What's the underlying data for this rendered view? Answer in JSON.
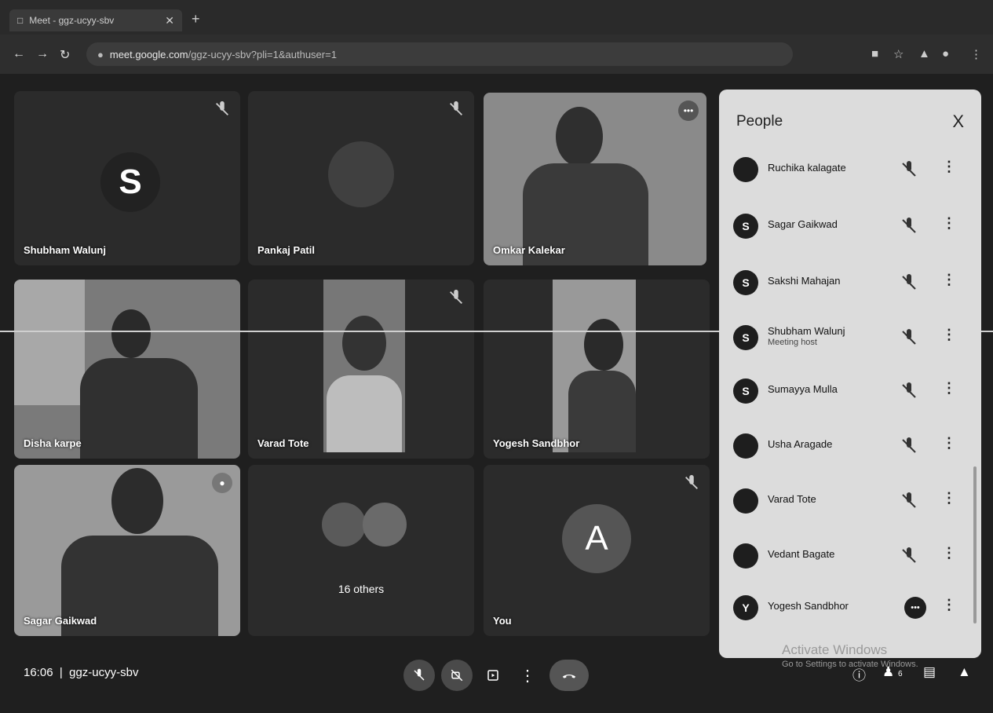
{
  "browser": {
    "tab_title": "Meet - ggz-ucyy-sbv",
    "url_domain": "meet.google.com",
    "url_path": "/ggz-ucyy-sbv?pli=1&authuser=1"
  },
  "tiles": [
    {
      "name": "Shubham Walunj",
      "initial": "S"
    },
    {
      "name": "Pankaj Patil"
    },
    {
      "name": "Omkar Kalekar"
    },
    {
      "name": "Disha karpe"
    },
    {
      "name": "Varad Tote"
    },
    {
      "name": "Yogesh Sandbhor"
    },
    {
      "name": "Sagar Gaikwad"
    },
    {
      "name": "16 others"
    },
    {
      "name": "You",
      "initial": "A"
    }
  ],
  "people_panel": {
    "title": "People",
    "close_label": "X",
    "participants": [
      {
        "name": "Ruchika kalagate",
        "initial": ""
      },
      {
        "name": "Sagar Gaikwad",
        "initial": "S"
      },
      {
        "name": "Sakshi Mahajan",
        "initial": "S"
      },
      {
        "name": "Shubham Walunj",
        "subtitle": "Meeting host",
        "initial": "S"
      },
      {
        "name": "Sumayya Mulla",
        "initial": "S"
      },
      {
        "name": "Usha Aragade",
        "initial": ""
      },
      {
        "name": "Varad Tote",
        "initial": ""
      },
      {
        "name": "Vedant Bagate",
        "initial": ""
      },
      {
        "name": "Yogesh Sandbhor",
        "initial": "Y"
      }
    ]
  },
  "bottom_bar": {
    "time": "16:06",
    "meeting_code": "ggz-ucyy-sbv",
    "participant_count": "6"
  },
  "watermark": {
    "line1": "Activate Windows",
    "line2": "Go to Settings to activate Windows."
  }
}
